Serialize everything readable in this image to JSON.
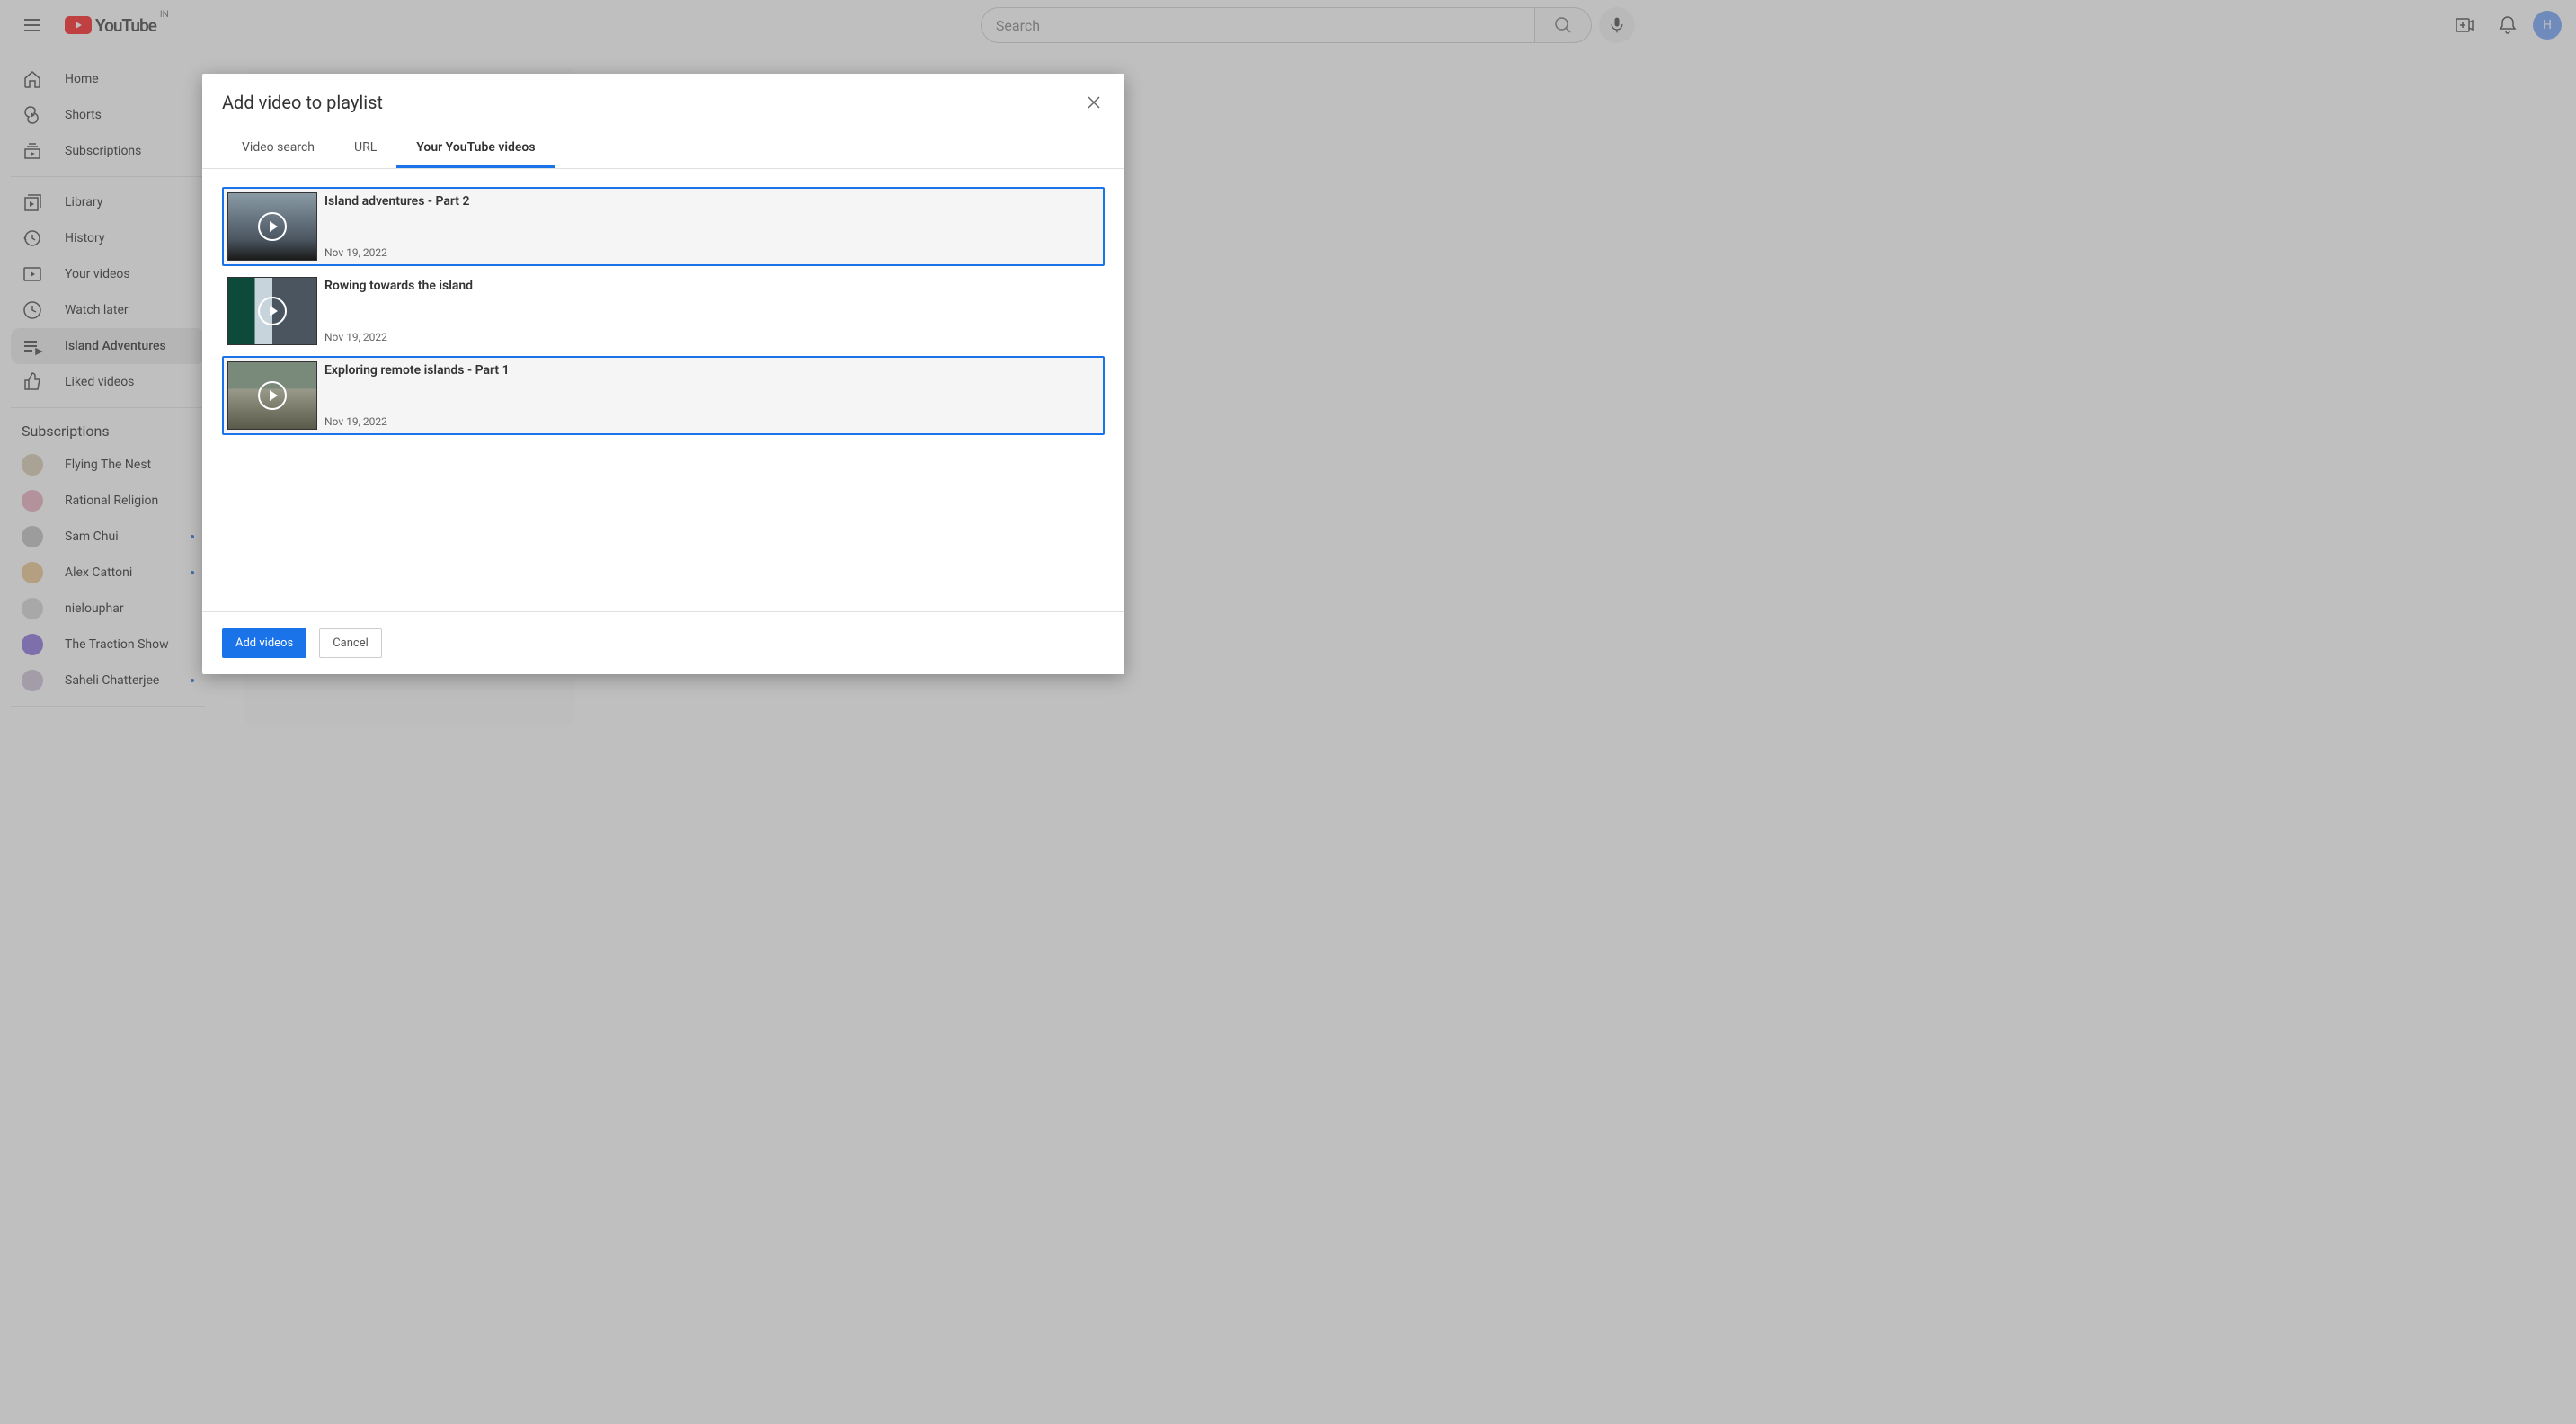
{
  "header": {
    "logo_text": "YouTube",
    "country": "IN",
    "search_placeholder": "Search",
    "avatar_initial": "H"
  },
  "sidebar": {
    "nav_primary": [
      {
        "label": "Home",
        "icon": "home"
      },
      {
        "label": "Shorts",
        "icon": "shorts"
      },
      {
        "label": "Subscriptions",
        "icon": "subscriptions"
      }
    ],
    "nav_secondary": [
      {
        "label": "Library",
        "icon": "library"
      },
      {
        "label": "History",
        "icon": "history"
      },
      {
        "label": "Your videos",
        "icon": "your-videos"
      },
      {
        "label": "Watch later",
        "icon": "watch-later"
      },
      {
        "label": "Island Adventures",
        "icon": "playlist",
        "active": true
      },
      {
        "label": "Liked videos",
        "icon": "liked"
      }
    ],
    "subs_heading": "Subscriptions",
    "subscriptions": [
      {
        "name": "Flying The Nest",
        "color": "#d4c5a8",
        "dot": false
      },
      {
        "name": "Rational Religion",
        "color": "#e8a5b8",
        "dot": false
      },
      {
        "name": "Sam Chui",
        "color": "#b8b8b8",
        "dot": true
      },
      {
        "name": "Alex Cattoni",
        "color": "#e8c080",
        "dot": true
      },
      {
        "name": "nielouphar",
        "color": "#d0d0d0",
        "dot": false
      },
      {
        "name": "The Traction Show",
        "color": "#7b5ed9",
        "dot": false
      },
      {
        "name": "Saheli Chatterjee",
        "color": "#c8b8d0",
        "dot": true
      }
    ]
  },
  "modal": {
    "title": "Add video to playlist",
    "tabs": [
      {
        "label": "Video search",
        "active": false
      },
      {
        "label": "URL",
        "active": false
      },
      {
        "label": "Your YouTube videos",
        "active": true
      }
    ],
    "videos": [
      {
        "title": "Island adventures - Part 2",
        "date": "Nov 19, 2022",
        "selected": true,
        "thumb": "thumb-1"
      },
      {
        "title": "Rowing towards the island",
        "date": "Nov 19, 2022",
        "selected": false,
        "thumb": "thumb-2"
      },
      {
        "title": "Exploring remote islands - Part 1",
        "date": "Nov 19, 2022",
        "selected": true,
        "thumb": "thumb-3"
      }
    ],
    "add_button": "Add videos",
    "cancel_button": "Cancel"
  }
}
